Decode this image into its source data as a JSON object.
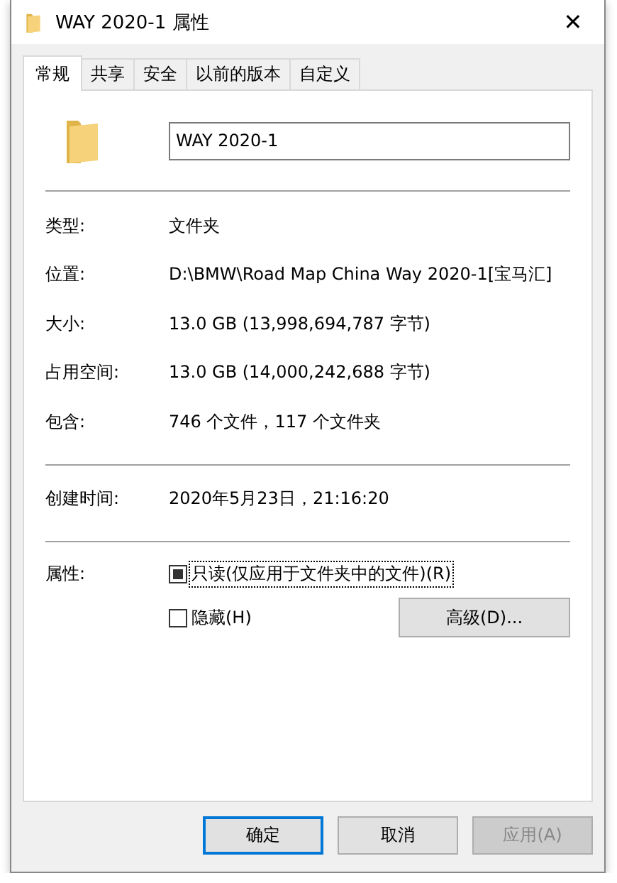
{
  "window": {
    "title": "WAY 2020-1 属性",
    "close": "✕"
  },
  "tabs": [
    {
      "label": "常规",
      "selected": true
    },
    {
      "label": "共享",
      "selected": false
    },
    {
      "label": "安全",
      "selected": false
    },
    {
      "label": "以前的版本",
      "selected": false
    },
    {
      "label": "自定义",
      "selected": false
    }
  ],
  "name_field": {
    "value": "WAY 2020-1"
  },
  "info_groups": [
    [
      {
        "label": "类型:",
        "value": "文件夹"
      },
      {
        "label": "位置:",
        "value": "D:\\BMW\\Road Map China Way 2020-1[宝马汇]"
      },
      {
        "label": "大小:",
        "value": "13.0 GB (13,998,694,787 字节)"
      },
      {
        "label": "占用空间:",
        "value": "13.0 GB (14,000,242,688 字节)"
      },
      {
        "label": "包含:",
        "value": "746 个文件，117 个文件夹"
      }
    ],
    [
      {
        "label": "创建时间:",
        "value": "2020年5月23日，21:16:20"
      }
    ]
  ],
  "attributes": {
    "label": "属性:",
    "checkboxes": [
      {
        "label": "只读(仅应用于文件夹中的文件)(R)",
        "checked": false,
        "indeterminate": true,
        "focused": true
      },
      {
        "label": "隐藏(H)",
        "checked": false,
        "indeterminate": false,
        "focused": false
      }
    ],
    "advanced_button": "高级(D)..."
  },
  "buttons": [
    {
      "label": "确定",
      "default": true,
      "disabled": false
    },
    {
      "label": "取消",
      "default": false,
      "disabled": false
    },
    {
      "label": "应用(A)",
      "default": false,
      "disabled": true
    }
  ]
}
